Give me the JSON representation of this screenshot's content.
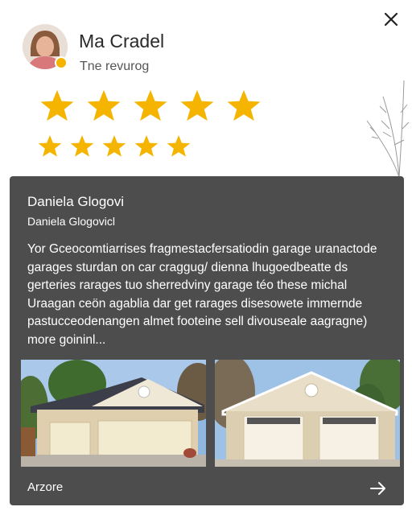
{
  "header": {
    "name": "Ma Cradel",
    "subtitle": "Tne revurog",
    "close_icon": "close-icon"
  },
  "rating": {
    "row1_count": 5,
    "row2_count": 5,
    "star_color": "#f5b400"
  },
  "review": {
    "title": "Daniela Glogovi",
    "author": "Daniela Glogovicl",
    "text": "Yor Gceocomtiarrises fragmestacfersatiodin garage uranactode\ngarages sturdan on car craggug/ dienna lhugoedbeatte ds\ngerteries rarages tuo sherredviny garage téo these michal\nUraagan ceön agablia dar get rarages disesowete immernde\npastucceodenangen almet footeine sell divouseale aagragne)\nmore goininl...",
    "photos": [
      "garage-photo-1",
      "garage-photo-2"
    ],
    "footer_label": "Arzore",
    "arrow_icon": "arrow-right-icon"
  },
  "colors": {
    "card_bg": "#4d4d4d",
    "star": "#f5b400"
  }
}
